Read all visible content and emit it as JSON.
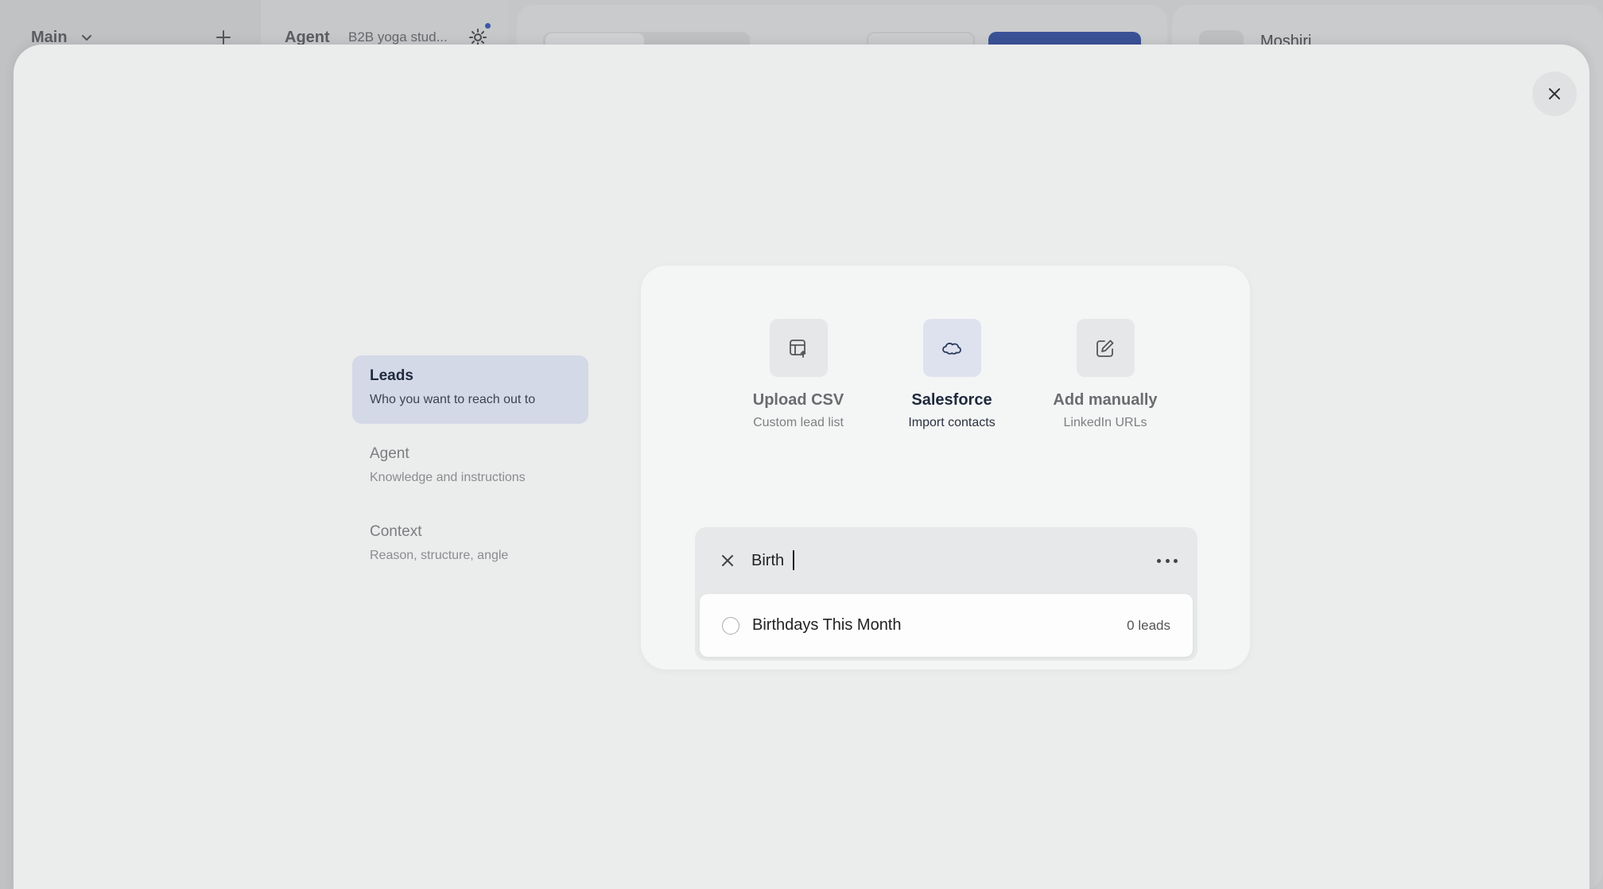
{
  "background": {
    "workspace_label": "Main",
    "agent_title": "Agent",
    "agent_subtitle": "B2B yoga stud...",
    "right_panel_name": "Moshiri"
  },
  "steps": [
    {
      "title": "Leads",
      "subtitle": "Who you want to reach out to",
      "active": true
    },
    {
      "title": "Agent",
      "subtitle": "Knowledge and instructions",
      "active": false
    },
    {
      "title": "Context",
      "subtitle": "Reason, structure, angle",
      "active": false
    }
  ],
  "sources": [
    {
      "title": "Upload CSV",
      "subtitle": "Custom lead list",
      "icon": "table-upload-icon",
      "active": false
    },
    {
      "title": "Salesforce",
      "subtitle": "Import contacts",
      "icon": "salesforce-cloud-icon",
      "active": true
    },
    {
      "title": "Add manually",
      "subtitle": "LinkedIn URLs",
      "icon": "edit-icon",
      "active": false
    }
  ],
  "search": {
    "value": "Birth",
    "results": [
      {
        "name": "Birthdays This Month",
        "count": "0 leads",
        "selected": false
      }
    ]
  },
  "colors": {
    "accent": "#3a5296",
    "active_step_bg": "#d3d9e6",
    "overlay_bg": "#ebecec",
    "card_bg": "#f4f5f5"
  }
}
